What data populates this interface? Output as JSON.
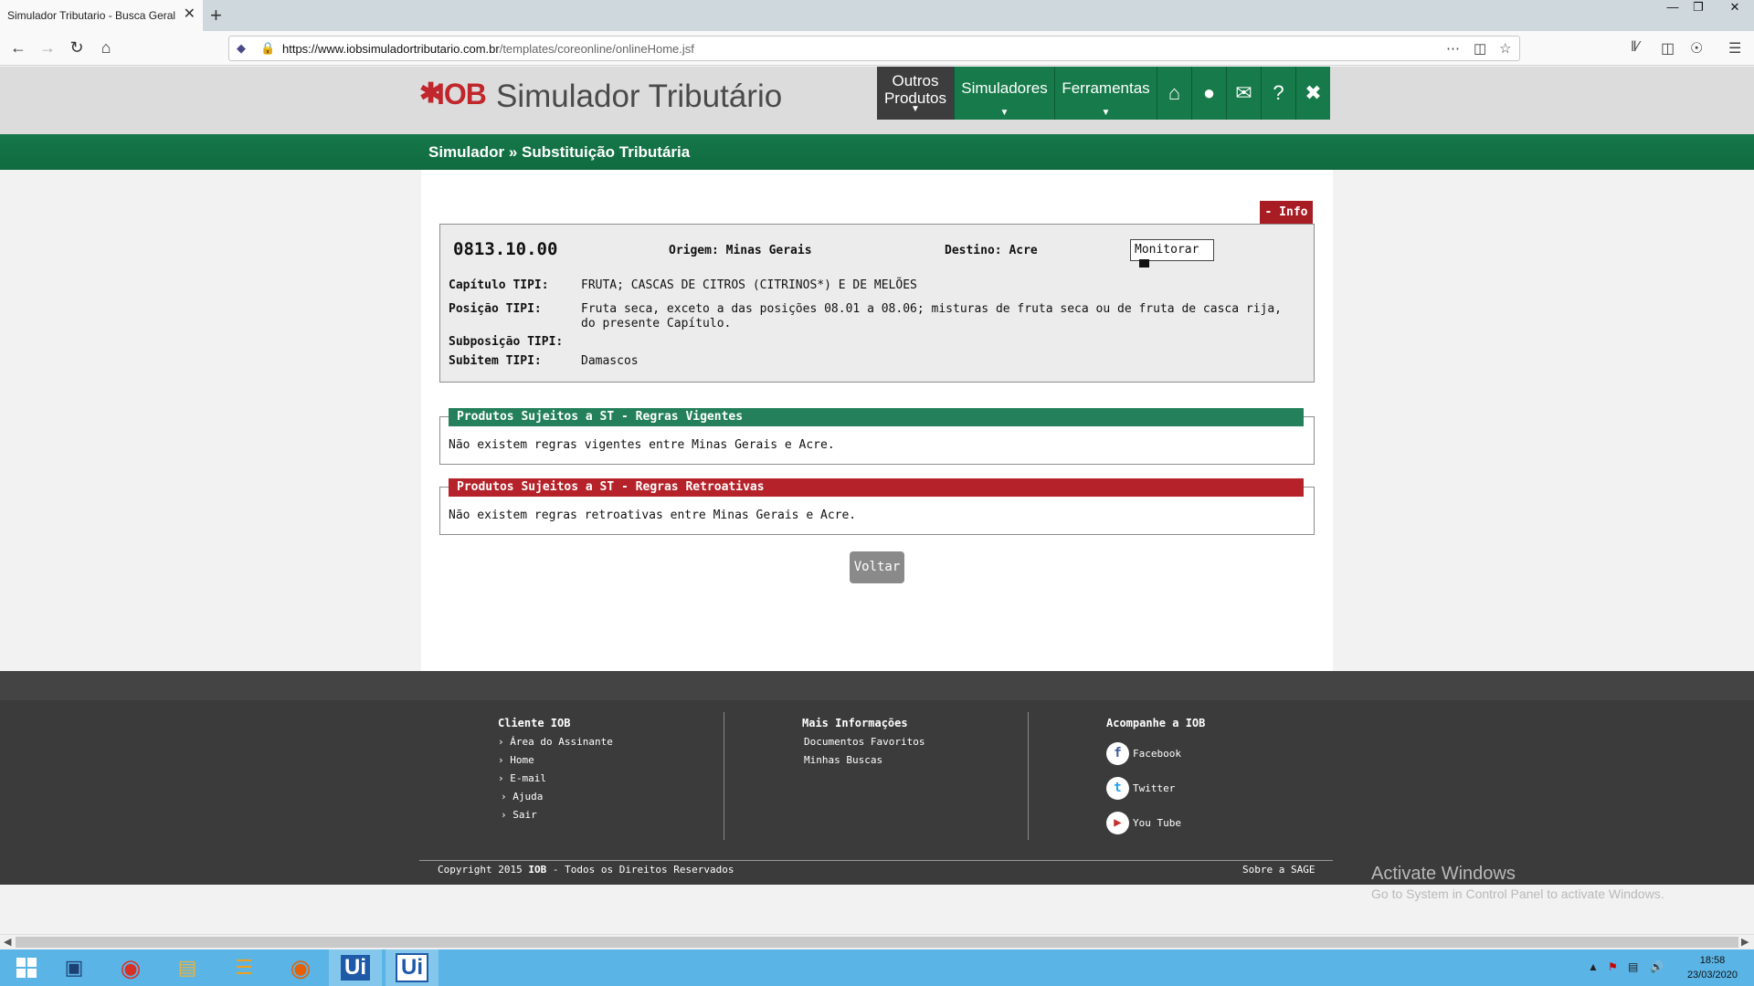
{
  "browser": {
    "tab_title": "Simulador Tributario - Busca Geral",
    "tab_close": "✕",
    "new_tab": "+",
    "url_host": "https://www.iobsimuladortributario.com.br",
    "url_path": "/templates/coreonline/onlineHome.jsf",
    "window_controls": [
      "—",
      "❐",
      "✕"
    ]
  },
  "header": {
    "logo_star": "✱",
    "logo_text": "IOB",
    "app_title": "Simulador Tributário",
    "nav": {
      "outros": "Outros Produtos",
      "simuladores": "Simuladores",
      "ferramentas": "Ferramentas",
      "arrow": "▼"
    }
  },
  "breadcrumb": "Simulador » Substituição Tributária",
  "info_tab": "- Info",
  "ncm": {
    "code": "0813.10.00",
    "origem": "Origem: Minas Gerais",
    "destino": "Destino: Acre",
    "monitor_label": "Monitorar",
    "rows": [
      {
        "label": "Capítulo TIPI:",
        "value": "FRUTA; CASCAS DE CITROS (CITRINOS*) E DE MELÕES"
      },
      {
        "label": "Posição TIPI:",
        "value": "Fruta seca, exceto a das posições 08.01 a 08.06; misturas de fruta seca ou de fruta de casca rija, do presente Capítulo."
      },
      {
        "label": "Subposição TIPI:",
        "value": ""
      },
      {
        "label": "Subitem TIPI:",
        "value": "Damascos"
      }
    ]
  },
  "rules": {
    "vigentes": {
      "title": "Produtos Sujeitos a ST - Regras Vigentes",
      "text": "Não existem regras vigentes entre Minas Gerais e Acre.",
      "color": "#23805a"
    },
    "retroativas": {
      "title": "Produtos Sujeitos a ST - Regras Retroativas",
      "text": "Não existem regras retroativas entre Minas Gerais e Acre.",
      "color": "#b6222a"
    }
  },
  "voltar_label": "Voltar",
  "footer": {
    "cliente_title": "Cliente IOB",
    "cliente_links": [
      "Área do Assinante",
      "Home",
      "E-mail",
      "Ajuda",
      "Sair"
    ],
    "mais_title": "Mais Informações",
    "mais_links": [
      "Documentos Favoritos",
      "Minhas Buscas"
    ],
    "acompanhe_title": "Acompanhe a IOB",
    "social": [
      "Facebook",
      "Twitter",
      "You Tube"
    ],
    "copyright_prefix": "Copyright 2015",
    "copyright_brand": "IOB",
    "copyright_suffix": "- Todos os Direitos Reservados",
    "sobre": "Sobre a SAGE"
  },
  "watermark": {
    "line1": "Activate Windows",
    "line2": "Go to System in Control Panel to activate Windows."
  },
  "taskbar": {
    "time": "18:58",
    "date": "23/03/2020"
  },
  "icons": {
    "home": "home-icon",
    "user": "user-icon",
    "mail": "mail-icon",
    "help": "help-icon",
    "close": "close-icon"
  }
}
